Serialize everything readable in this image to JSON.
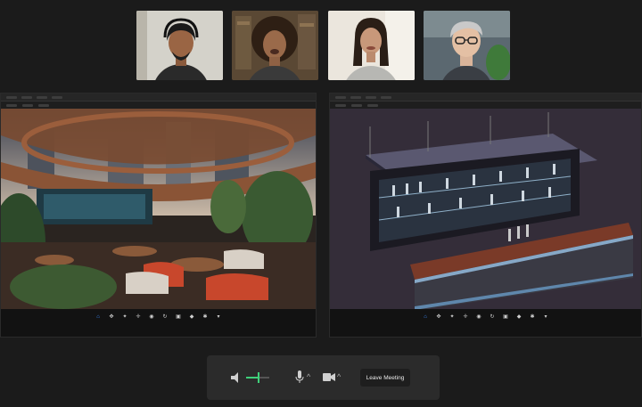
{
  "participants": [
    {
      "id": "p1",
      "icon": "person-video"
    },
    {
      "id": "p2",
      "icon": "person-video"
    },
    {
      "id": "p3",
      "icon": "person-video"
    },
    {
      "id": "p4",
      "icon": "avatar-video"
    }
  ],
  "left_viewport": {
    "scene": "rooftop-restaurant-render",
    "nav_active_index": 0
  },
  "right_viewport": {
    "scene": "bar-counter-render",
    "nav_active_index": 0
  },
  "controls": {
    "speaker_icon": "speaker-icon",
    "volume_level": 0.55,
    "mic_icon": "microphone-icon",
    "camera_icon": "camera-icon",
    "leave_label": "Leave Meeting"
  },
  "colors": {
    "accent_green": "#3fd07a",
    "accent_blue": "#3b8cff",
    "background": "#1b1b1b",
    "control_bar": "#2b2b2b"
  }
}
